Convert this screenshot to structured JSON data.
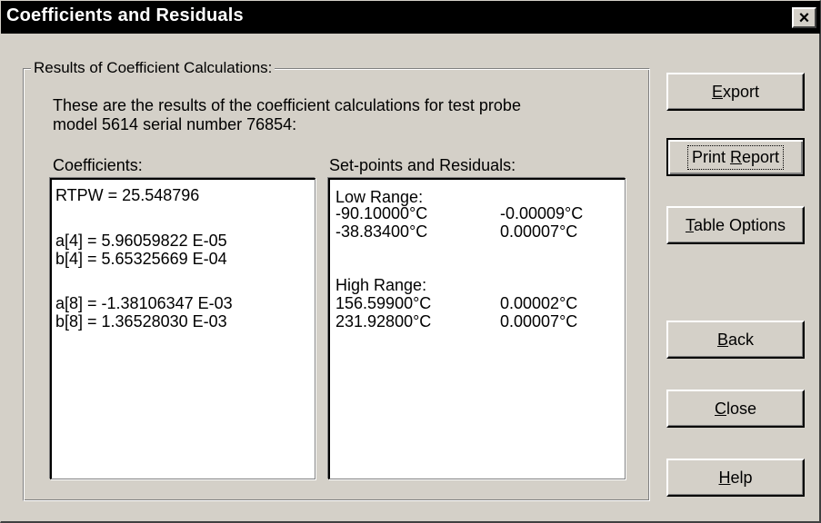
{
  "window": {
    "title": "Coefficients and Residuals",
    "close_symbol": "×"
  },
  "group": {
    "label": "Results of Coefficient Calculations:",
    "description_line1": "These are the results of the coefficient calculations for test probe",
    "description_line2": "model 5614 serial number 76854:"
  },
  "coefficients": {
    "label": "Coefficients:",
    "lines": [
      "RTPW = 25.548796",
      "a[4] = 5.96059822 E-05",
      "b[4] = 5.65325669 E-04",
      "a[8] = -1.38106347 E-03",
      "b[8] = 1.36528030 E-03"
    ]
  },
  "residuals": {
    "label": "Set-points and Residuals:",
    "low_range_label": "Low Range:",
    "low_range": [
      {
        "setpoint": "-90.10000°C",
        "residual": "-0.00009°C"
      },
      {
        "setpoint": "-38.83400°C",
        "residual": "0.00007°C"
      }
    ],
    "high_range_label": "High Range:",
    "high_range": [
      {
        "setpoint": "156.59900°C",
        "residual": "0.00002°C"
      },
      {
        "setpoint": "231.92800°C",
        "residual": "0.00007°C"
      }
    ]
  },
  "buttons": {
    "export": {
      "pre": "",
      "key": "E",
      "post": "xport"
    },
    "print_report": {
      "pre": "Print ",
      "key": "R",
      "post": "eport"
    },
    "table_options": {
      "pre": "",
      "key": "T",
      "post": "able Options"
    },
    "back": {
      "pre": "",
      "key": "B",
      "post": "ack"
    },
    "close": {
      "pre": "",
      "key": "C",
      "post": "lose"
    },
    "help": {
      "pre": "",
      "key": "H",
      "post": "elp"
    }
  }
}
